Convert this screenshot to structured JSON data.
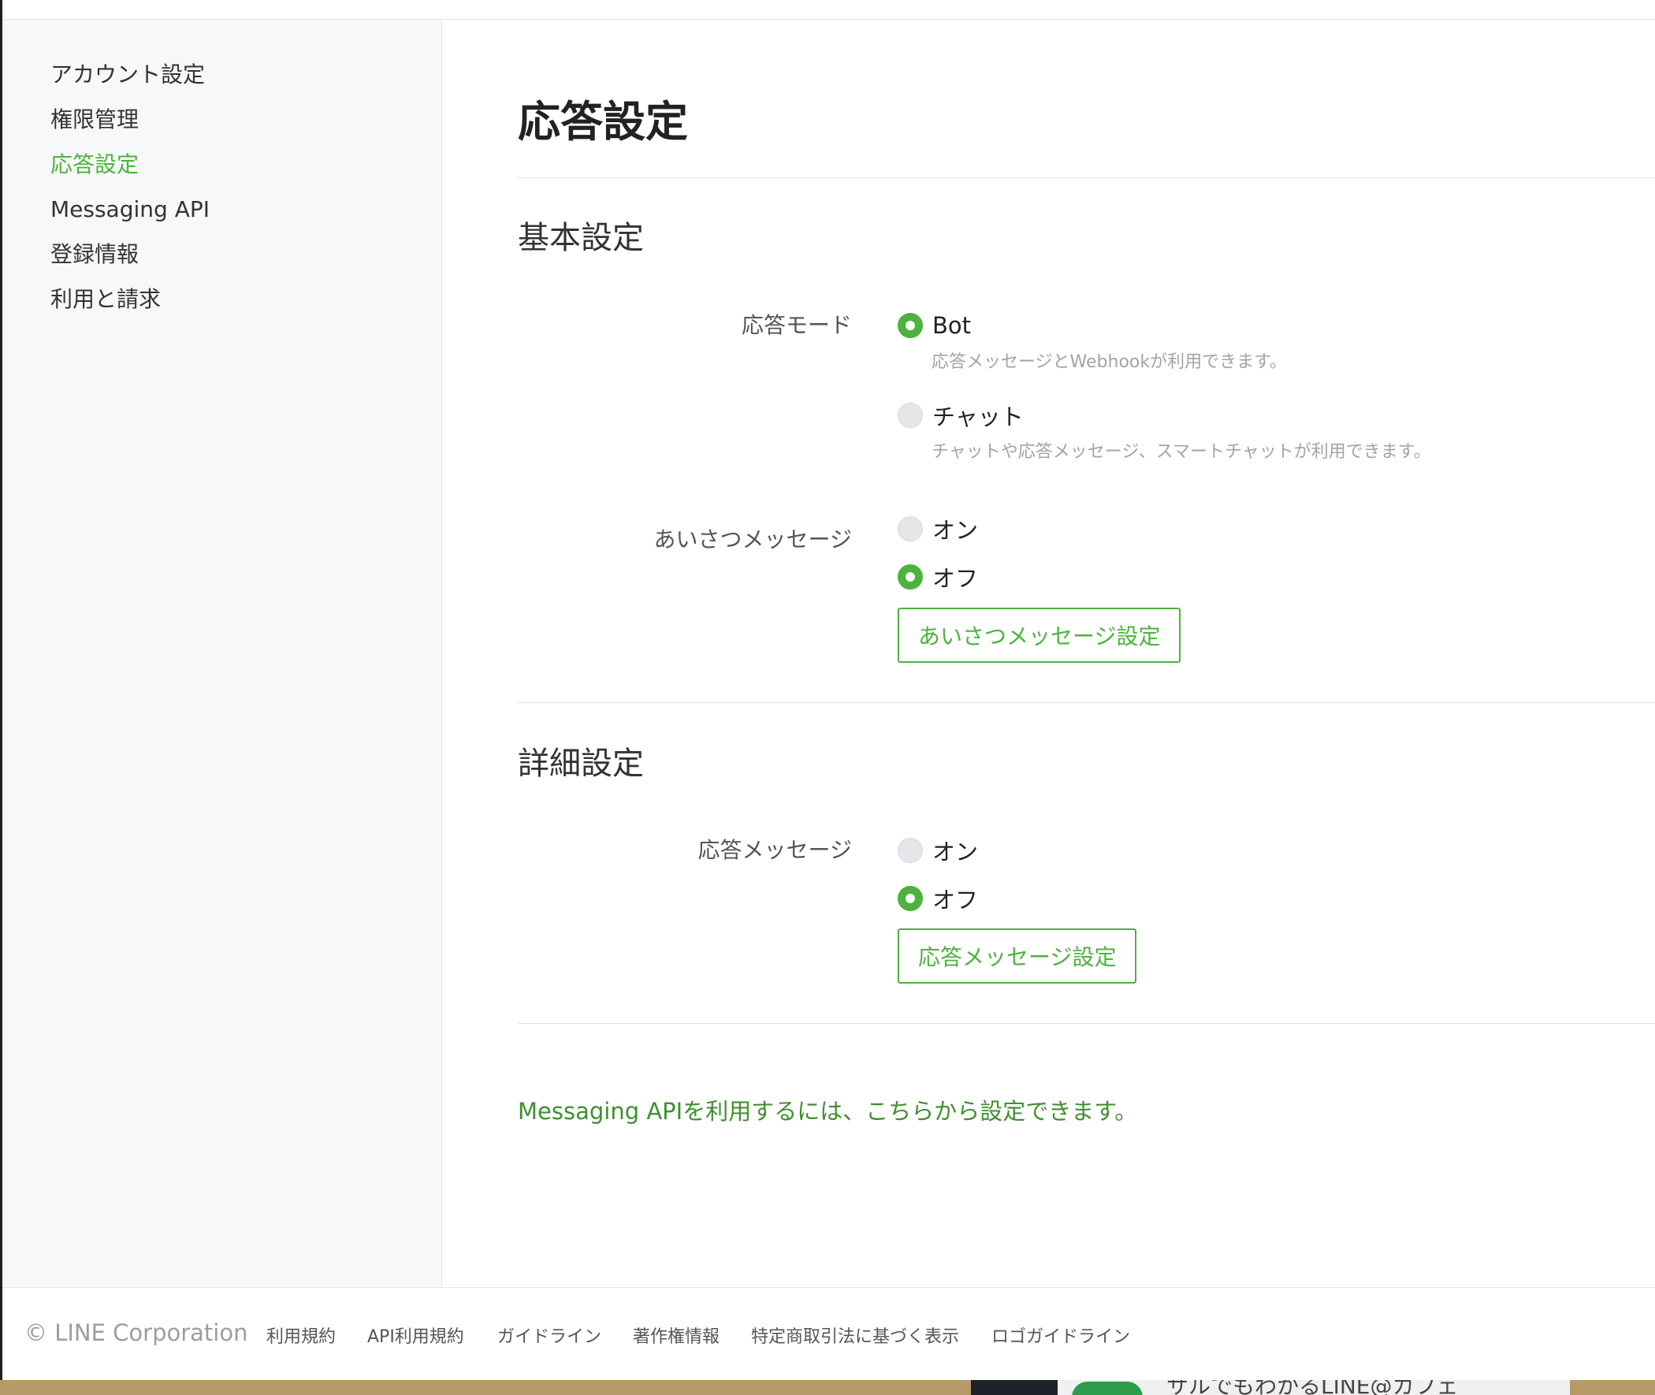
{
  "sidebar": {
    "items": [
      {
        "label": "アカウント設定",
        "active": false
      },
      {
        "label": "権限管理",
        "active": false
      },
      {
        "label": "応答設定",
        "active": true
      },
      {
        "label": "Messaging API",
        "active": false
      },
      {
        "label": "登録情報",
        "active": false
      },
      {
        "label": "利用と請求",
        "active": false
      }
    ]
  },
  "main": {
    "title": "応答設定",
    "basic": {
      "title": "基本設定",
      "response_mode": {
        "label": "応答モード",
        "options": [
          {
            "label": "Bot",
            "checked": true,
            "help": "応答メッセージとWebhookが利用できます。"
          },
          {
            "label": "チャット",
            "checked": false,
            "help": "チャットや応答メッセージ、スマートチャットが利用できます。"
          }
        ]
      },
      "greeting": {
        "label": "あいさつメッセージ",
        "options": [
          {
            "label": "オン",
            "checked": false
          },
          {
            "label": "オフ",
            "checked": true
          }
        ],
        "button": "あいさつメッセージ設定"
      }
    },
    "detail": {
      "title": "詳細設定",
      "auto_reply": {
        "label": "応答メッセージ",
        "options": [
          {
            "label": "オン",
            "checked": false
          },
          {
            "label": "オフ",
            "checked": true
          }
        ],
        "button": "応答メッセージ設定"
      }
    },
    "api_link": "Messaging APIを利用するには、こちらから設定できます。"
  },
  "footer": {
    "copyright": "© LINE Corporation",
    "links": [
      "利用規約",
      "API利用規約",
      "ガイドライン",
      "著作権情報",
      "特定商取引法に基づく表示",
      "ロゴガイドライン"
    ]
  },
  "background_window": {
    "text": "サルでもわかるLINE@カフェ"
  },
  "colors": {
    "accent": "#4cb33d",
    "link": "#3f8f2f",
    "sidebar_bg": "#f7f8fa",
    "border": "#e3e5e8"
  }
}
